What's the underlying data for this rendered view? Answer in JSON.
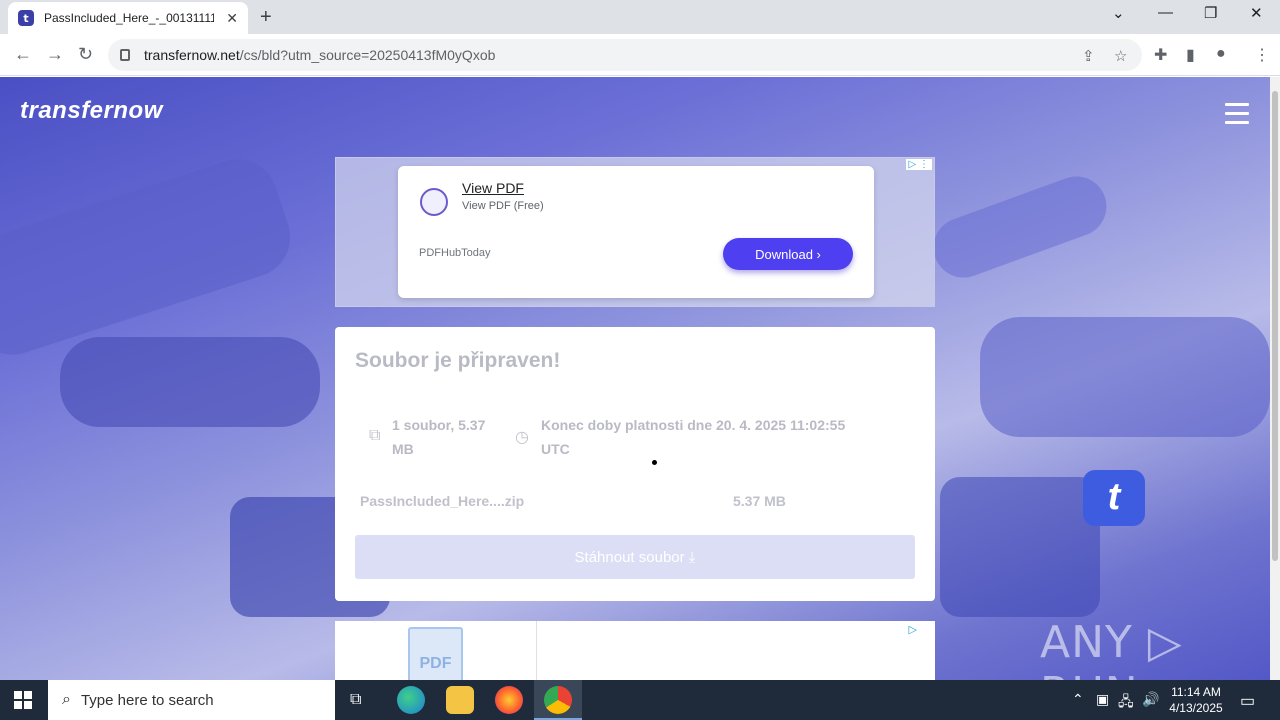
{
  "browser": {
    "tab_title": "PassIncluded_Here_-_00131111_",
    "tab_favicon": "t",
    "new_tab": "+",
    "url_host": "transfernow.net",
    "url_path": "/cs/bld?utm_source=20250413fM0yQxob"
  },
  "page": {
    "logo": "transfernow",
    "ad": {
      "title": "View PDF",
      "subtitle": "View PDF (Free)",
      "brand": "PDFHubToday",
      "button": "Download ›"
    },
    "card": {
      "title": "Soubor je připraven!",
      "files_count": "1 soubor, 5.37",
      "files_size_line": "MB",
      "expiry_line1": "Konec doby platnosti dne 20. 4. 2025 11:02:55",
      "expiry_line2": "UTC",
      "file_name": "PassIncluded_Here....zip",
      "file_size": "5.37 MB",
      "download_button": "Stáhnout soubor  ⤓"
    },
    "ad2_pdf_label": "PDF",
    "logo_tile": "t",
    "watermark": "ANY ▷ RUN"
  },
  "taskbar": {
    "search_placeholder": "Type here to search",
    "time": "11:14 AM",
    "date": "4/13/2025"
  },
  "colors": {
    "accent": "#4e3ff0",
    "page_bg": "#6b6fd6",
    "taskbar": "#1f2b3a"
  }
}
